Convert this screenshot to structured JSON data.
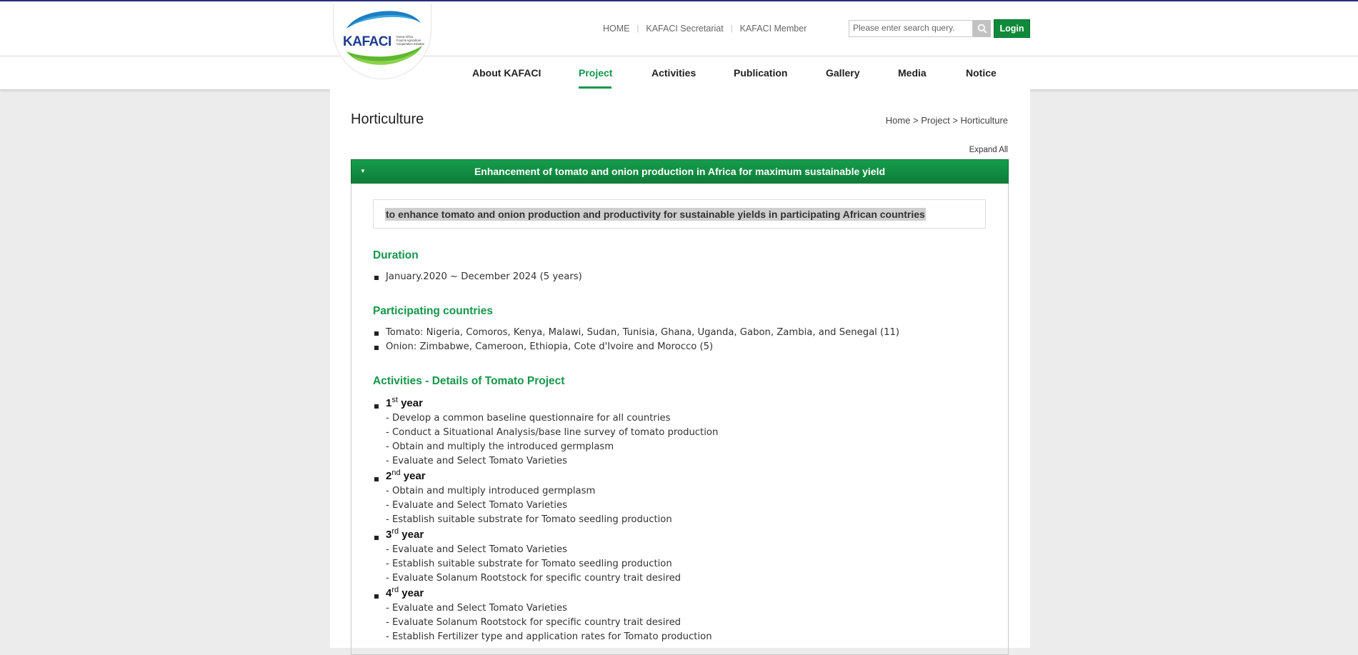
{
  "header": {
    "logo_text": "KAFACI",
    "logo_tagline": [
      "Korea-Africa",
      "Food & Agriculture",
      "Cooperation Initiative"
    ],
    "util_links": [
      "HOME",
      "KAFACI Secretariat",
      "KAFACI Member"
    ],
    "search_placeholder": "Please enter search query.",
    "login_label": "Login"
  },
  "nav": {
    "items": [
      "About KAFACI",
      "Project",
      "Activities",
      "Publication",
      "Gallery",
      "Media",
      "Notice"
    ],
    "active": "Project"
  },
  "page": {
    "title": "Horticulture",
    "breadcrumb": "Home > Project > Horticulture",
    "expand_all": "Expand All"
  },
  "accordion": {
    "title": "Enhancement of tomato and onion production in Africa for maximum sustainable yield",
    "objective": "to enhance tomato and onion production and productivity for sustainable yields in participating African countries",
    "duration_heading": "Duration",
    "duration": [
      "January.2020 ~ December 2024 (5 years)"
    ],
    "countries_heading": "Participating countries",
    "countries": [
      "Tomato: Nigeria, Comoros, Kenya, Malawi, Sudan, Tunisia, Ghana, Uganda, Gabon, Zambia, and Senegal (11)",
      "Onion: Zimbabwe, Cameroon, Ethiopia, Cote d'Ivoire and Morocco (5)"
    ],
    "activities_heading": "Activities - Details of Tomato Project",
    "years": [
      {
        "num": "1",
        "sup": "st",
        "word": "year",
        "items": [
          "- Develop a common baseline questionnaire for all countries",
          "- Conduct a Situational Analysis/base line survey of tomato production",
          "- Obtain and multiply the introduced germplasm",
          "- Evaluate and Select Tomato Varieties"
        ]
      },
      {
        "num": "2",
        "sup": "nd",
        "word": "year",
        "items": [
          "- Obtain and multiply introduced germplasm",
          "- Evaluate and Select Tomato Varieties",
          "- Establish suitable substrate for Tomato seedling production"
        ]
      },
      {
        "num": "3",
        "sup": "rd",
        "word": "year",
        "items": [
          "- Evaluate and Select Tomato Varieties",
          "- Establish suitable substrate for Tomato seedling production",
          "- Evaluate Solanum Rootstock for specific country trait desired"
        ]
      },
      {
        "num": "4",
        "sup": "rd",
        "word": "year",
        "items": [
          "- Evaluate and Select Tomato Varieties",
          "- Evaluate Solanum Rootstock for specific country trait desired",
          "- Establish Fertilizer type and application rates for Tomato production"
        ]
      }
    ]
  },
  "colors": {
    "brand_green": "#14964a",
    "top_line": "#2a2f7a",
    "login_bg": "#0f8a3a"
  }
}
